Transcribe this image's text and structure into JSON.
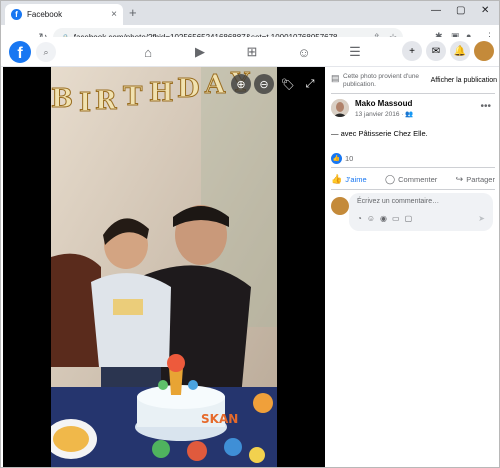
{
  "browser": {
    "tab_title": "Facebook",
    "tab_favicon": "f",
    "tab_close": "×",
    "new_tab": "+",
    "url": "facebook.com/photo/?fbid=10256565241686887&set=t.100010768057678",
    "window_controls": [
      "—",
      "▢",
      "✕"
    ]
  },
  "facebook": {
    "logo": "f",
    "nav_icons": [
      "home-icon",
      "watch-icon",
      "marketplace-icon",
      "groups-icon",
      "menu-icon"
    ]
  },
  "panel": {
    "notice_text": "Cette photo provient d'une publication.",
    "notice_link": "Afficher la publication",
    "author": "Mako Massoud",
    "date": "13 janvier 2016 ·",
    "caption": "— avec Pâtisserie Chez Elle.",
    "reaction_count": "10",
    "like_label": "J'aime",
    "comment_label": "Commenter",
    "share_label": "Partager",
    "comment_placeholder": "Écrivez un commentaire…"
  },
  "colors": {
    "brand": "#1877f2",
    "text_secondary": "#65676b"
  }
}
